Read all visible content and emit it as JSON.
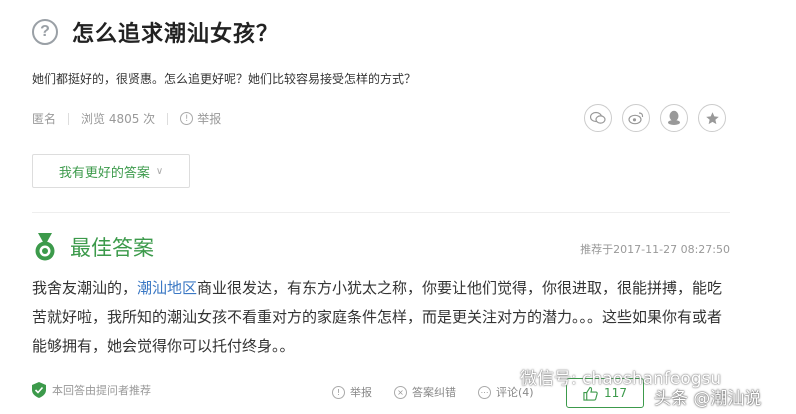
{
  "question": {
    "title": "怎么追求潮汕女孩？",
    "description": "她们都挺好的，很贤惠。怎么追更好呢？她们比较容易接受怎样的方式？"
  },
  "meta": {
    "anonymous": "匿名",
    "views": "浏览 4805 次",
    "report": "举报"
  },
  "share_icons": [
    "wechat-icon",
    "weibo-icon",
    "qq-icon",
    "star-icon"
  ],
  "better_answer_button": "我有更好的答案",
  "best_answer": {
    "heading": "最佳答案",
    "recommended_time": "推荐于2017-11-27 08:27:50",
    "text_1": "我舍友潮汕的，",
    "link": "潮汕地区",
    "text_2": "商业很发达，有东方小犹太之称，你要让他们觉得，你很进取，很能拼搏，能吃苦就好啦，我所知的潮汕女孩不看重对方的家庭条件怎样，而是更关注对方的潜力。。。这些如果你有或者能够拥有，她会觉得你可以托付终身。。"
  },
  "footer": {
    "recommended_note": "本回答由提问者推荐",
    "report": "举报",
    "correct": "答案纠错",
    "comment": "评论(4)",
    "likes": "117"
  },
  "watermark": {
    "wechat": "微信号: chaoshanfeogsu",
    "toutiao": "头条 @潮汕说"
  },
  "colors": {
    "accent_green": "#3c9a4b",
    "link_blue": "#3b78c4"
  }
}
